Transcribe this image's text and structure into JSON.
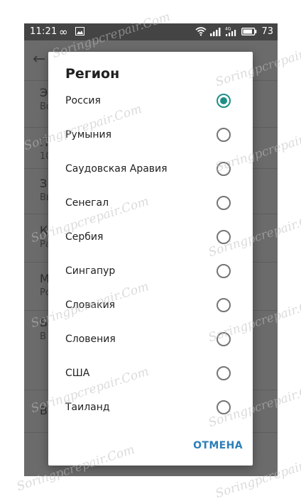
{
  "status_bar": {
    "time": "11:21",
    "battery": "73",
    "icons": [
      "infinity-icon",
      "image-icon",
      "wifi-icon",
      "signal-icon",
      "signal-4g-icon",
      "battery-icon"
    ]
  },
  "dialog": {
    "title": "Регион",
    "options": [
      {
        "label": "Россия",
        "selected": true
      },
      {
        "label": "Румыния",
        "selected": false
      },
      {
        "label": "Саудовская Аравия",
        "selected": false
      },
      {
        "label": "Сенегал",
        "selected": false
      },
      {
        "label": "Сербия",
        "selected": false
      },
      {
        "label": "Сингапур",
        "selected": false
      },
      {
        "label": "Словакия",
        "selected": false
      },
      {
        "label": "Словения",
        "selected": false
      },
      {
        "label": "США",
        "selected": false
      },
      {
        "label": "Таиланд",
        "selected": false
      }
    ],
    "cancel_label": "ОТМЕНА"
  },
  "background_list": {
    "items": [
      {
        "title": "Э",
        "subtitle": "Во"
      },
      {
        "title": "П",
        "subtitle": "10"
      },
      {
        "title": "З",
        "subtitle": "Вв"
      },
      {
        "title": "К",
        "subtitle": "Ра"
      },
      {
        "title": "М",
        "subtitle": "Ро"
      },
      {
        "title": "Б",
        "subtitle": "В"
      },
      {
        "title": "В",
        "subtitle": ""
      }
    ]
  },
  "colors": {
    "accent": "#1e8e86",
    "cancel": "#2c7fb8",
    "scrim": "#6b6b6b",
    "status_bar": "#444444"
  },
  "watermark_text": "Soringpcrepair.Com"
}
